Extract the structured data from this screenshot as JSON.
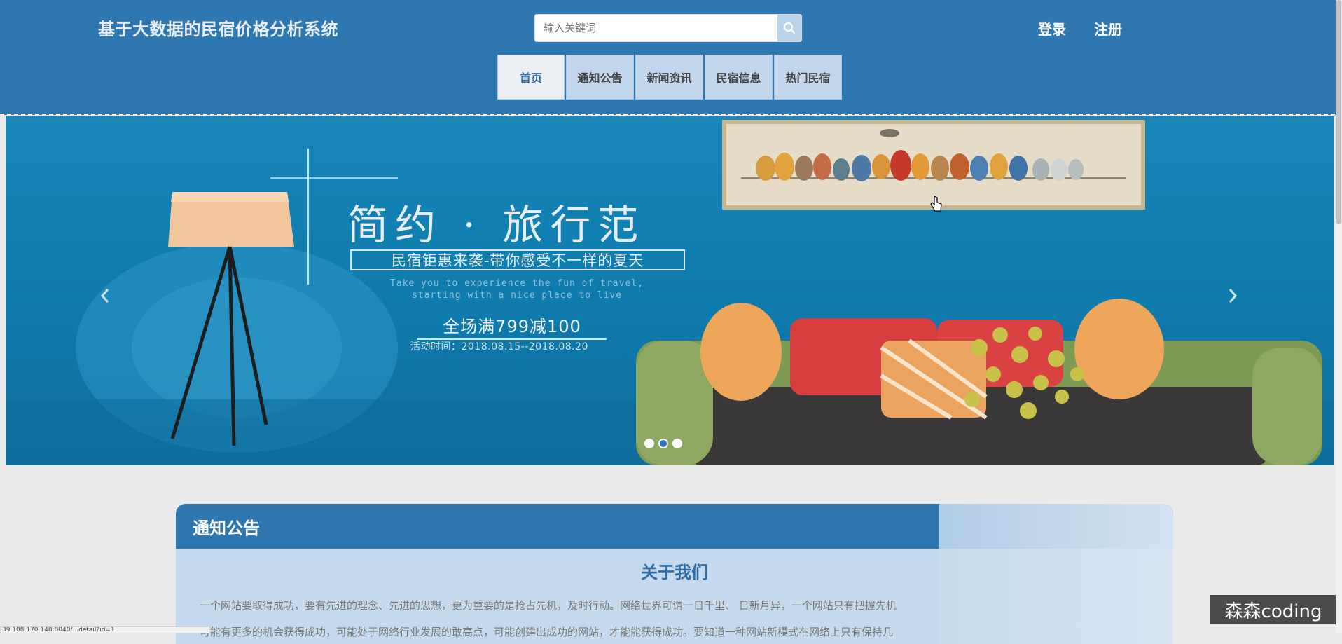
{
  "header": {
    "site_title": "基于大数据的民宿价格分析系统",
    "search_placeholder": "输入关键词",
    "login": "登录",
    "register": "注册"
  },
  "nav": {
    "items": [
      "首页",
      "通知公告",
      "新闻资讯",
      "民宿信息",
      "热门民宿"
    ],
    "active": "首页"
  },
  "banner": {
    "headline": "简约 · 旅行范",
    "tagline": "民宿钜惠来袭-带你感受不一样的夏天",
    "english_line1": "Take you to experience the fun of travel,",
    "english_line2": "starting with a nice place to live",
    "promo": "全场满799减100",
    "date": "活动时间：2018.08.15--2018.08.20",
    "dots_count": 3,
    "active_dot": 2
  },
  "notice": {
    "title": "通知公告",
    "subtitle": "关于我们",
    "p1": "一个网站要取得成功，要有先进的理念、先进的思想，更为重要的是抢占先机，及时行动。网络世界可谓一日千里、 日新月异，一个网站只有把握先机",
    "p2": "可能有更多的机会获得成功，可能处于网络行业发展的敢高点，可能创建出成功的网站，才能能获得成功。要知道一种网站新模式在网络上只有保持几"
  },
  "watermark": "森森coding",
  "statusbar": "39.108.170.148:8040/...detail?id=1"
}
